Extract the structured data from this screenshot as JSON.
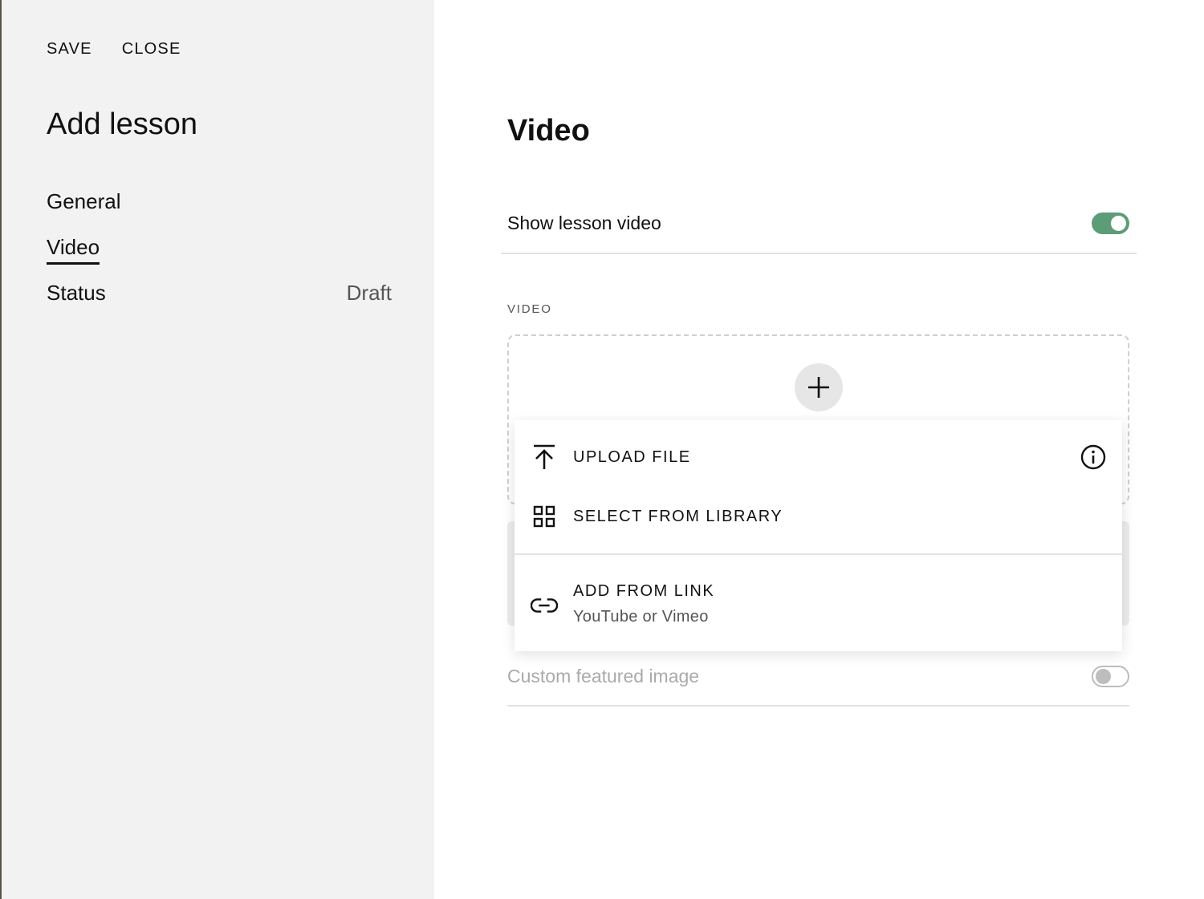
{
  "toolbar": {
    "save_label": "SAVE",
    "close_label": "CLOSE"
  },
  "sidebar": {
    "title": "Add lesson",
    "items": [
      {
        "label": "General",
        "value": ""
      },
      {
        "label": "Video",
        "value": ""
      },
      {
        "label": "Status",
        "value": "Draft"
      }
    ],
    "active_item": "Video"
  },
  "main": {
    "title": "Video",
    "show_video": {
      "label": "Show lesson video",
      "enabled": true
    },
    "video_field_label": "VIDEO",
    "menu": {
      "upload": "UPLOAD FILE",
      "library": "SELECT FROM LIBRARY",
      "link": "ADD FROM LINK",
      "link_sub": "YouTube or Vimeo"
    },
    "custom_image": {
      "label": "Custom featured image",
      "enabled": false
    }
  },
  "colors": {
    "toggle_on": "#5c9c77",
    "sidebar_bg": "#f2f2f2"
  },
  "icons": [
    "upload-icon",
    "grid-library-icon",
    "link-icon",
    "info-icon",
    "plus-icon"
  ]
}
